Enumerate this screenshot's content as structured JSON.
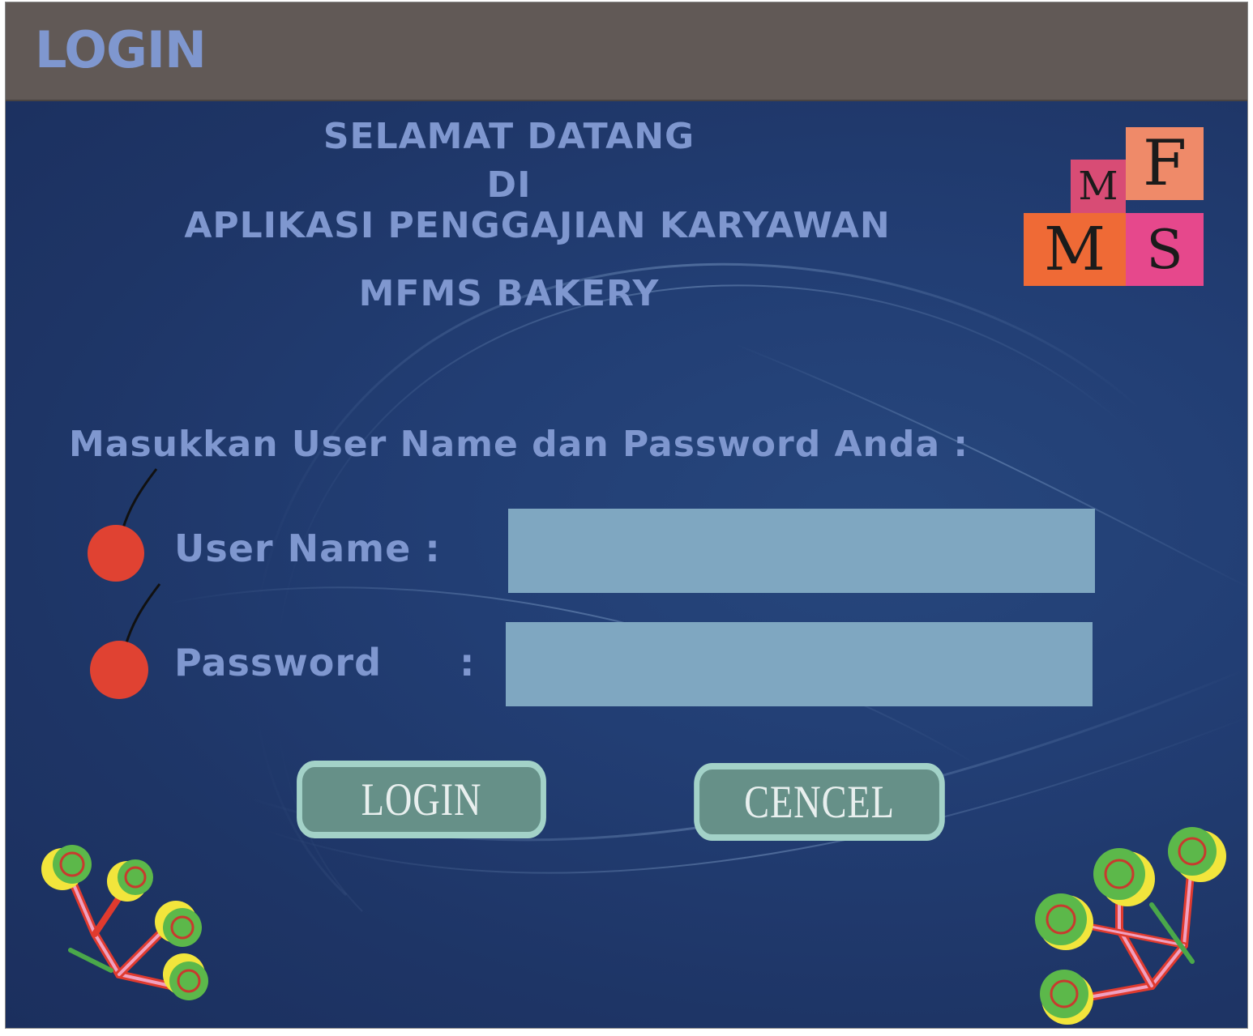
{
  "window": {
    "title": "LOGIN"
  },
  "welcome": {
    "line1": "SELAMAT DATANG",
    "line2": "DI",
    "line3": "APLIKASI PENGGAJIAN KARYAWAN",
    "line4": "MFMS BAKERY"
  },
  "logo": {
    "letters": [
      "F",
      "M",
      "M",
      "S"
    ],
    "colors": [
      "#ef8a69",
      "#d84c75",
      "#ef6a36",
      "#e6488c"
    ]
  },
  "form": {
    "prompt": "Masukkan User Name dan Password Anda :",
    "username_label": "User Name :",
    "username_value": "",
    "password_label": "Password",
    "password_colon": ":",
    "password_value": ""
  },
  "buttons": {
    "login_label": "LOGIN",
    "cancel_label": "CENCEL"
  },
  "colors": {
    "titlebar": "#615956",
    "text_accent": "#7f97cf",
    "background": "#223e74",
    "input_fill": "#7fa7c1",
    "button_fill": "#669088",
    "button_border": "#a3d2c8",
    "bullet_red": "#e04232"
  }
}
